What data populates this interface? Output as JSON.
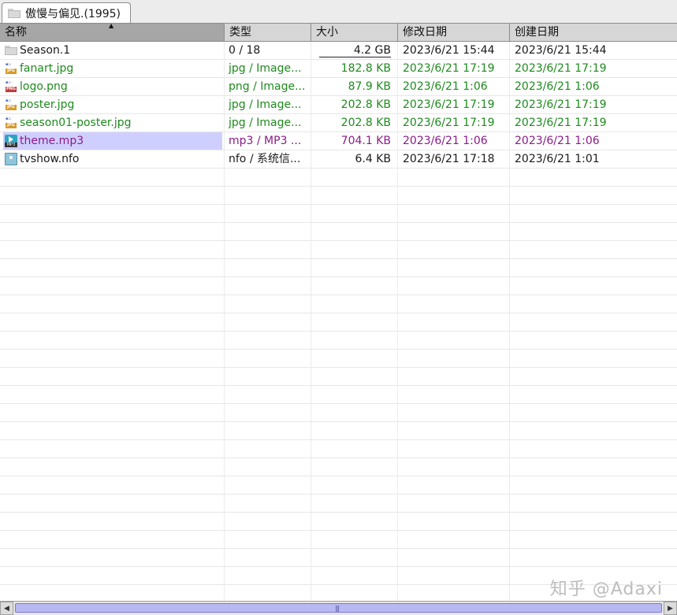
{
  "tab": {
    "title": "傲慢与偏见.(1995)",
    "icon": "folder-icon"
  },
  "columns": [
    {
      "key": "name",
      "label": "名称",
      "sorted": true
    },
    {
      "key": "type",
      "label": "类型"
    },
    {
      "key": "size",
      "label": "大小"
    },
    {
      "key": "modified",
      "label": "修改日期"
    },
    {
      "key": "created",
      "label": "创建日期"
    }
  ],
  "rows": [
    {
      "name": "Season.1",
      "type": "0 / 18",
      "size": "4.2 GB",
      "modified": "2023/6/21 15:44",
      "created": "2023/6/21 15:44",
      "icon": "folder-icon",
      "color": "#1a1a1a"
    },
    {
      "name": "fanart.jpg",
      "type": "jpg / Image...",
      "size": "182.8 KB",
      "modified": "2023/6/21 17:19",
      "created": "2023/6/21 17:19",
      "icon": "jpg-file-icon",
      "color": "#1f8a1f"
    },
    {
      "name": "logo.png",
      "type": "png / Image...",
      "size": "87.9 KB",
      "modified": "2023/6/21 1:06",
      "created": "2023/6/21 1:06",
      "icon": "png-file-icon",
      "color": "#1f8a1f"
    },
    {
      "name": "poster.jpg",
      "type": "jpg / Image...",
      "size": "202.8 KB",
      "modified": "2023/6/21 17:19",
      "created": "2023/6/21 17:19",
      "icon": "jpg-file-icon",
      "color": "#1f8a1f"
    },
    {
      "name": "season01-poster.jpg",
      "type": "jpg / Image...",
      "size": "202.8 KB",
      "modified": "2023/6/21 17:19",
      "created": "2023/6/21 17:19",
      "icon": "jpg-file-icon",
      "color": "#1f8a1f"
    },
    {
      "name": "theme.mp3",
      "type": "mp3 / MP3 ...",
      "size": "704.1 KB",
      "modified": "2023/6/21 1:06",
      "created": "2023/6/21 1:06",
      "icon": "mp3-file-icon",
      "color": "#8a1b8a",
      "selected": true
    },
    {
      "name": "tvshow.nfo",
      "type": "nfo / 系统信...",
      "size": "6.4 KB",
      "modified": "2023/6/21 17:18",
      "created": "2023/6/21 1:01",
      "icon": "nfo-file-icon",
      "color": "#1a1a1a"
    }
  ],
  "watermark": "知乎 @Adaxi",
  "colors": {
    "header_bg": "#d6d6d6",
    "sorted_header_bg": "#a6a6a6",
    "selection": "#cfcfff",
    "scroll_thumb": "#b8b8f2"
  }
}
